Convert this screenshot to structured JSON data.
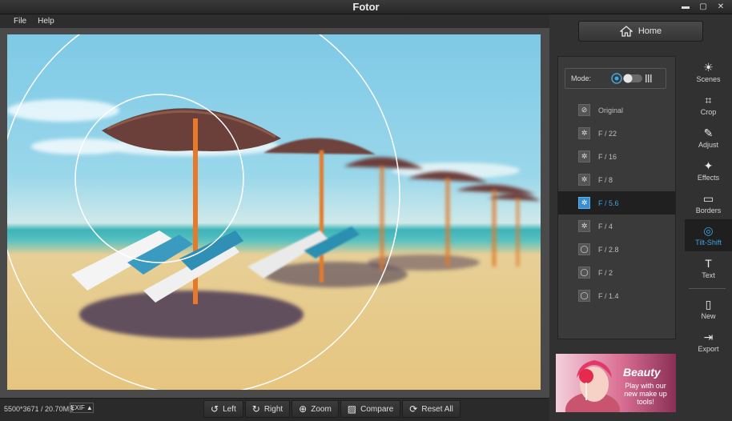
{
  "window": {
    "title": "Fotor",
    "controls": [
      "▬",
      "▢",
      "✕"
    ]
  },
  "menu": {
    "items": [
      "File",
      "Help"
    ]
  },
  "status": {
    "image_info": "5500*3671 / 20.70MB",
    "exif_label": "EXIF"
  },
  "toolbar": {
    "left": "Left",
    "right": "Right",
    "zoom": "Zoom",
    "compare": "Compare",
    "reset_all": "Reset All"
  },
  "home": {
    "label": "Home"
  },
  "tilt_shift": {
    "mode_label": "Mode:",
    "options": [
      {
        "label": "Original",
        "selected": false
      },
      {
        "label": "F / 22",
        "selected": false
      },
      {
        "label": "F / 16",
        "selected": false
      },
      {
        "label": "F / 8",
        "selected": false
      },
      {
        "label": "F / 5.6",
        "selected": true
      },
      {
        "label": "F / 4",
        "selected": false
      },
      {
        "label": "F / 2.8",
        "selected": false
      },
      {
        "label": "F / 2",
        "selected": false
      },
      {
        "label": "F / 1.4",
        "selected": false
      }
    ]
  },
  "ad": {
    "title": "Beauty",
    "text": "Play with our new make up tools!"
  },
  "side_tools": [
    {
      "label": "Scenes",
      "icon": "scenes-icon",
      "active": false
    },
    {
      "label": "Crop",
      "icon": "crop-icon",
      "active": false
    },
    {
      "label": "Adjust",
      "icon": "adjust-icon",
      "active": false
    },
    {
      "label": "Effects",
      "icon": "effects-icon",
      "active": false
    },
    {
      "label": "Borders",
      "icon": "borders-icon",
      "active": false
    },
    {
      "label": "Tilt-Shift",
      "icon": "tilt-shift-icon",
      "active": true
    },
    {
      "label": "Text",
      "icon": "text-icon",
      "active": false
    },
    {
      "label": "New",
      "icon": "new-icon",
      "active": false
    },
    {
      "label": "Export",
      "icon": "export-icon",
      "active": false
    }
  ],
  "colors": {
    "accent": "#3fa6e0",
    "background": "#2b2b2b"
  }
}
